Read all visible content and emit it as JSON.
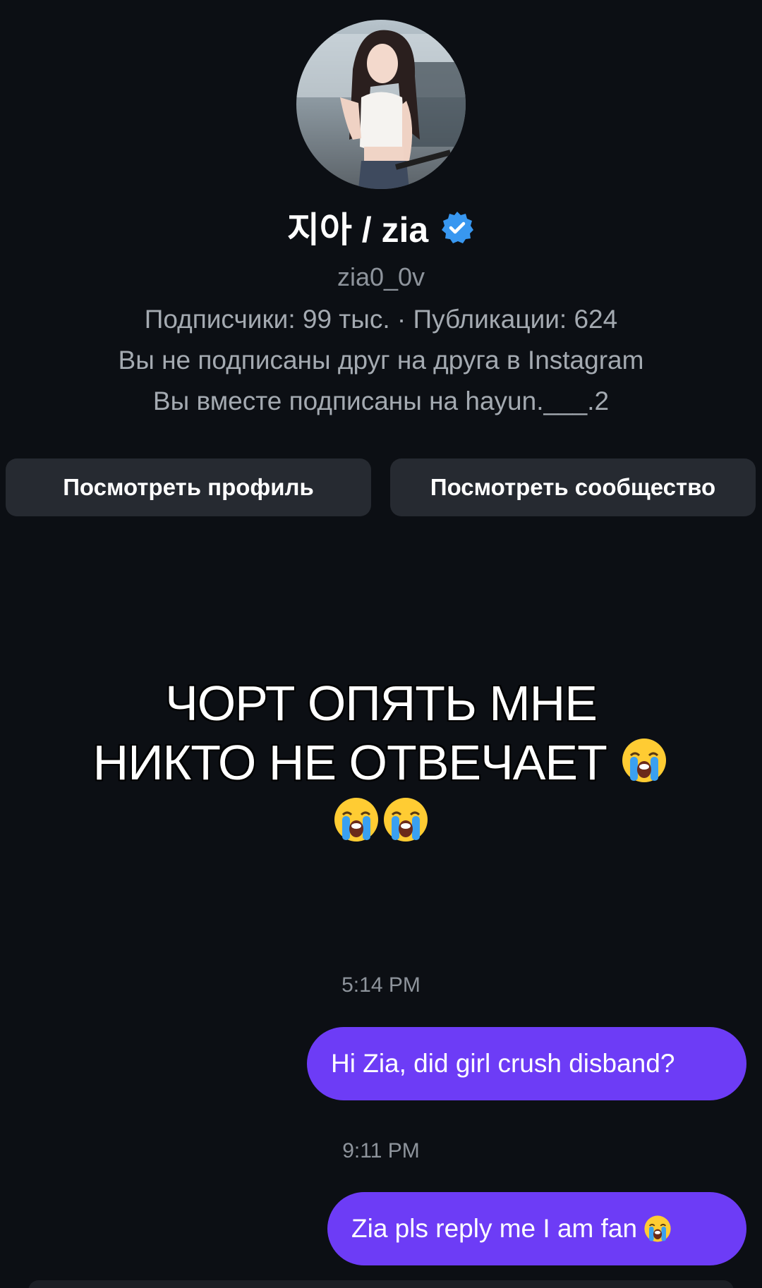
{
  "profile": {
    "display_name": "지아 / zia",
    "username": "zia0_0v",
    "stats": "Подписчики: 99 тыс. · Публикации: 624",
    "mutual_status": "Вы не подписаны друг на друга в Instagram",
    "mutual_follow": "Вы вместе подписаны на hayun.___.2",
    "avatar_icon": "profile-photo",
    "verified_icon": "verified-badge-icon"
  },
  "actions": {
    "view_profile": "Посмотреть профиль",
    "view_community": "Посмотреть сообщество"
  },
  "overlay_text": {
    "line1": "ЧОРТ ОПЯТЬ МНЕ",
    "line2": "НИКТО НЕ ОТВЕЧАЕТ",
    "emoji_icon": "loudly-crying-face-icon"
  },
  "messages": [
    {
      "time": "5:14 PM",
      "text": "Hi Zia, did girl crush disband?"
    },
    {
      "time": "9:11 PM",
      "text": "Zia pls reply me I am fan"
    }
  ],
  "colors": {
    "background": "#0c0f14",
    "bubble": "#6d3cf6",
    "button": "#262a31",
    "verified": "#3897f0"
  }
}
